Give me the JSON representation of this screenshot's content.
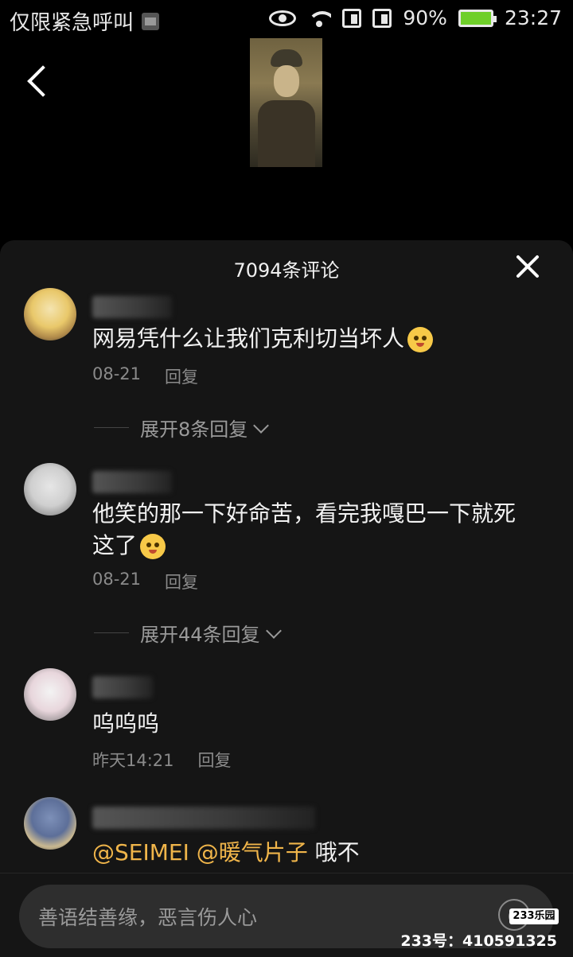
{
  "status_bar": {
    "carrier": "仅限紧急呼叫",
    "battery": "90%",
    "time": "23:27"
  },
  "panel": {
    "title": "7094条评论"
  },
  "comments": [
    {
      "text": "网易凭什么让我们克利切当坏人",
      "date": "08-21",
      "reply_label": "回复",
      "expand_label": "展开8条回复"
    },
    {
      "text_line1": "他笑的那一下好命苦，看完我嘎巴一下就死",
      "text_line2": "这了",
      "date": "08-21",
      "reply_label": "回复",
      "expand_label": "展开44条回复"
    },
    {
      "text": "呜呜呜",
      "date": "昨天14:21",
      "reply_label": "回复"
    },
    {
      "mention1": "@SEIMEI",
      "mention2": "@暖气片子",
      "text": "哦不"
    }
  ],
  "input": {
    "placeholder": "善语结善缘，恶言伤人心"
  },
  "watermark": {
    "badge": "233乐园",
    "text": "233号：410591325"
  },
  "colors": {
    "panel_bg": "#151515",
    "mention": "#f0b54a",
    "battery": "#6fcf2a"
  }
}
